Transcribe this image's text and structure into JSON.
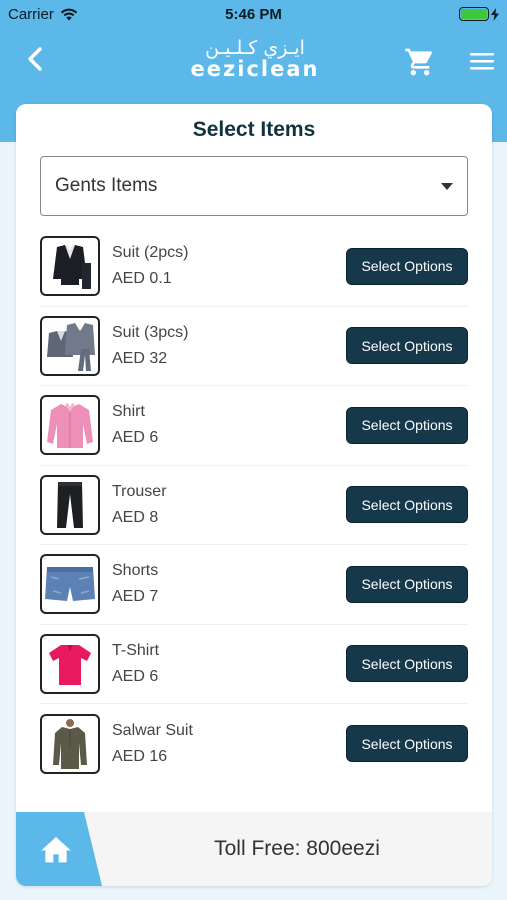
{
  "status_bar": {
    "carrier": "Carrier",
    "time": "5:46 PM",
    "battery_level": 1.0,
    "battery_color": "#3ec63e"
  },
  "header": {
    "logo_arabic": "ايـزي كـلـيـن",
    "logo_english": "eeziclean",
    "back_icon": "chevron-left-icon",
    "cart_icon": "cart-icon",
    "menu_icon": "hamburger-menu-icon",
    "background": "#5bb8e8"
  },
  "main": {
    "title": "Select Items",
    "category_dropdown": {
      "selected": "Gents Items"
    },
    "items": [
      {
        "name": "Suit (2pcs)",
        "price": "AED 0.1",
        "button": "Select Options",
        "icon": "suit-2pcs-image"
      },
      {
        "name": "Suit (3pcs)",
        "price": "AED 32",
        "button": "Select Options",
        "icon": "suit-3pcs-image"
      },
      {
        "name": "Shirt",
        "price": "AED 6",
        "button": "Select Options",
        "icon": "shirt-image"
      },
      {
        "name": "Trouser",
        "price": "AED 8",
        "button": "Select Options",
        "icon": "trouser-image"
      },
      {
        "name": "Shorts",
        "price": "AED 7",
        "button": "Select Options",
        "icon": "shorts-image"
      },
      {
        "name": "T-Shirt",
        "price": "AED 6",
        "button": "Select Options",
        "icon": "tshirt-image"
      },
      {
        "name": "Salwar Suit",
        "price": "AED 16",
        "button": "Select Options",
        "icon": "salwar-suit-image"
      }
    ],
    "button_color": "#15394b"
  },
  "footer": {
    "toll_free": "Toll Free: 800eezi",
    "home_icon": "home-icon"
  }
}
